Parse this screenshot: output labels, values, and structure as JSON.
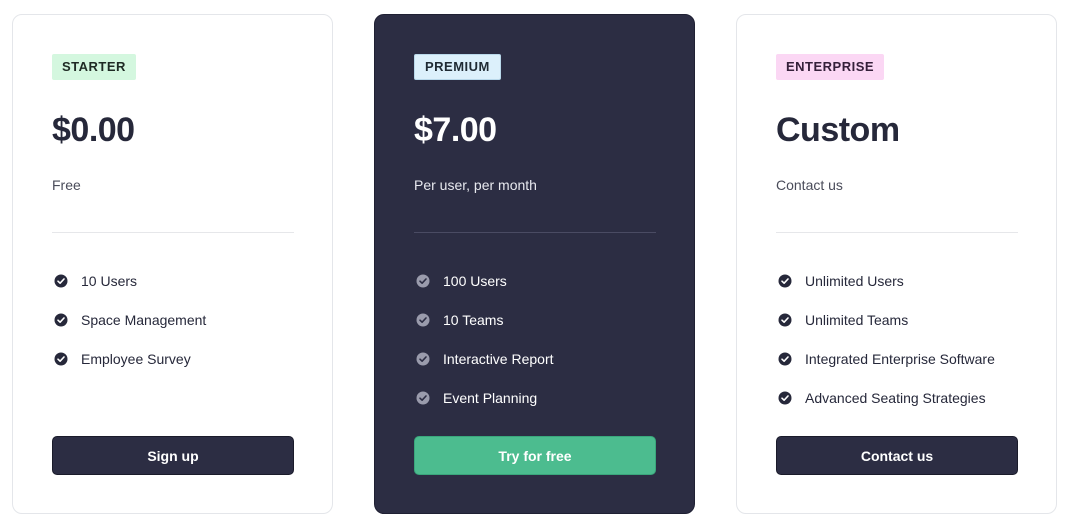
{
  "plans": [
    {
      "badge": "STARTER",
      "price": "$0.00",
      "note": "Free",
      "features": [
        "10 Users",
        "Space Management",
        "Employee Survey"
      ],
      "button": "Sign up"
    },
    {
      "badge": "PREMIUM",
      "price": "$7.00",
      "note": "Per user, per month",
      "features": [
        "100 Users",
        "10 Teams",
        "Interactive Report",
        "Event Planning"
      ],
      "button": "Try for free"
    },
    {
      "badge": "ENTERPRISE",
      "price": "Custom",
      "note": "Contact us",
      "features": [
        "Unlimited Users",
        "Unlimited Teams",
        "Integrated Enterprise Software",
        "Advanced Seating Strategies"
      ],
      "button": "Contact us"
    }
  ],
  "icons": {
    "feature": "check-circle-icon"
  },
  "colors": {
    "dark_card": "#2c2d43",
    "cta_green": "#4cbc8f",
    "starter_badge": "#d4f7df",
    "premium_badge": "#dcf0fb",
    "enterprise_badge": "#fbd7f4"
  }
}
